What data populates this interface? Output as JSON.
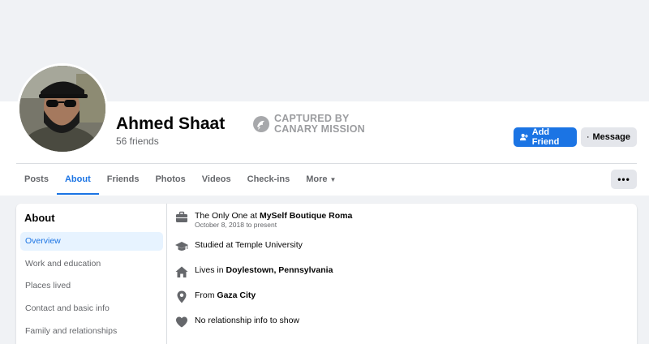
{
  "profile": {
    "name": "Ahmed Shaat",
    "friends": "56 friends"
  },
  "watermark": {
    "line1": "CAPTURED BY",
    "line2": "CANARY MISSION"
  },
  "actions": {
    "add_friend": "Add Friend",
    "message": "Message",
    "more": "•••"
  },
  "tabs": [
    {
      "label": "Posts"
    },
    {
      "label": "About"
    },
    {
      "label": "Friends"
    },
    {
      "label": "Photos"
    },
    {
      "label": "Videos"
    },
    {
      "label": "Check-ins"
    },
    {
      "label": "More"
    }
  ],
  "about": {
    "title": "About",
    "nav": [
      {
        "label": "Overview"
      },
      {
        "label": "Work and education"
      },
      {
        "label": "Places lived"
      },
      {
        "label": "Contact and basic info"
      },
      {
        "label": "Family and relationships"
      }
    ],
    "work": {
      "prefix": "The Only One at ",
      "place": "MySelf Boutique Roma",
      "dates": "October 8, 2018 to present"
    },
    "education": {
      "text": "Studied at Temple University"
    },
    "lives": {
      "prefix": "Lives in ",
      "place": "Doylestown, Pennsylvania"
    },
    "from": {
      "prefix": "From ",
      "place": "Gaza City"
    },
    "relationship": {
      "text": "No relationship info to show"
    }
  },
  "colors": {
    "accent": "#1b74e4",
    "muted_text": "#65676b",
    "background": "#f0f2f5"
  },
  "icons": [
    "briefcase-icon",
    "graduation-cap-icon",
    "home-icon",
    "location-pin-icon",
    "heart-icon",
    "add-friend-icon",
    "messenger-icon",
    "canary-logo-icon",
    "caret-down-icon"
  ]
}
